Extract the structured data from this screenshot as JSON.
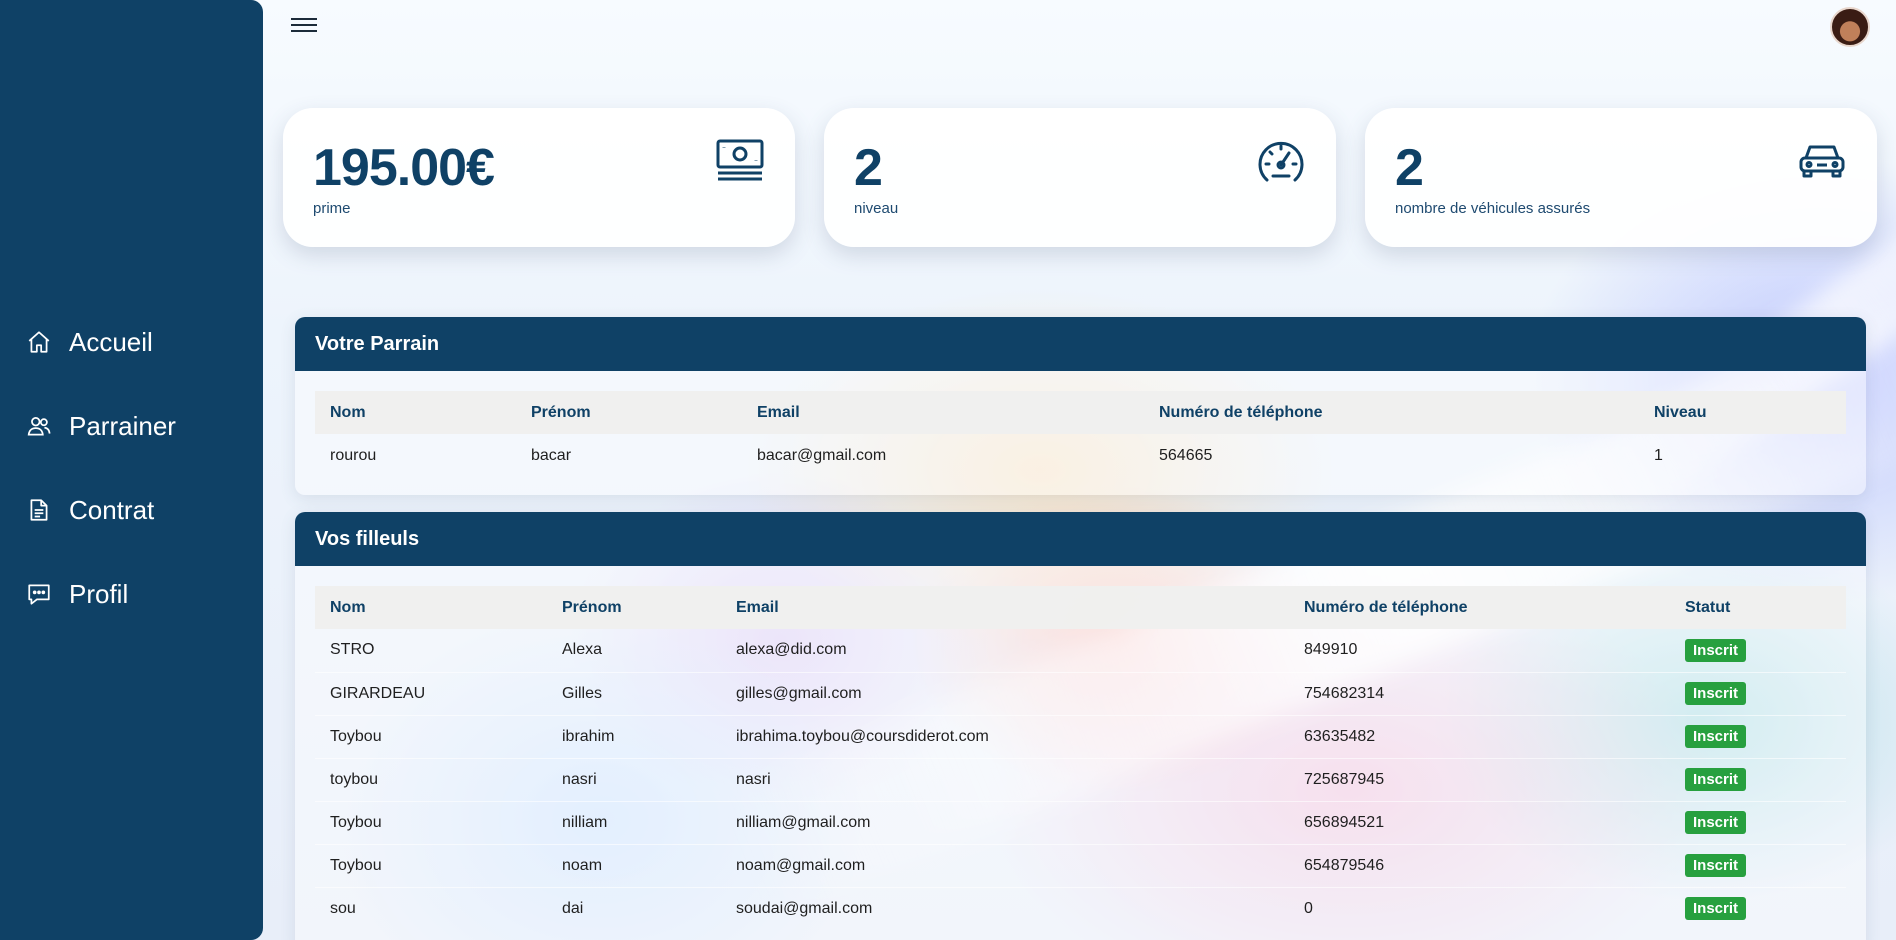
{
  "sidebar": {
    "items": [
      {
        "label": "Accueil",
        "icon": "home-icon"
      },
      {
        "label": "Parrainer",
        "icon": "users-icon"
      },
      {
        "label": "Contrat",
        "icon": "document-icon"
      },
      {
        "label": "Profil",
        "icon": "chat-icon"
      }
    ]
  },
  "header": {
    "menu_icon": "hamburger-menu-icon",
    "avatar": "user-avatar"
  },
  "stats": [
    {
      "value": "195.00€",
      "label": "prime",
      "icon": "banknote-icon"
    },
    {
      "value": "2",
      "label": "niveau",
      "icon": "speedometer-icon"
    },
    {
      "value": "2",
      "label": "nombre de véhicules assurés",
      "icon": "car-icon"
    }
  ],
  "parrain": {
    "title": "Votre Parrain",
    "columns": [
      "Nom",
      "Prénom",
      "Email",
      "Numéro de téléphone",
      "Niveau"
    ],
    "rows": [
      [
        "rourou",
        "bacar",
        "bacar@gmail.com",
        "564665",
        "1"
      ]
    ]
  },
  "filleuls": {
    "title": "Vos filleuls",
    "columns": [
      "Nom",
      "Prénom",
      "Email",
      "Numéro de téléphone",
      "Statut"
    ],
    "rows": [
      [
        "STRO",
        "Alexa",
        "alexa@did.com",
        "849910",
        "Inscrit"
      ],
      [
        "GIRARDEAU",
        "Gilles",
        "gilles@gmail.com",
        "754682314",
        "Inscrit"
      ],
      [
        "Toybou",
        "ibrahim",
        "ibrahima.toybou@coursdiderot.com",
        "63635482",
        "Inscrit"
      ],
      [
        "toybou",
        "nasri",
        "nasri",
        "725687945",
        "Inscrit"
      ],
      [
        "Toybou",
        "nilliam",
        "nilliam@gmail.com",
        "656894521",
        "Inscrit"
      ],
      [
        "Toybou",
        "noam",
        "noam@gmail.com",
        "654879546",
        "Inscrit"
      ],
      [
        "sou",
        "dai",
        "soudai@gmail.com",
        "0",
        "Inscrit"
      ]
    ]
  },
  "colors": {
    "primary": "#0f4166",
    "badge_success": "#27a03f",
    "table_header_bg": "#f0f0ee"
  }
}
